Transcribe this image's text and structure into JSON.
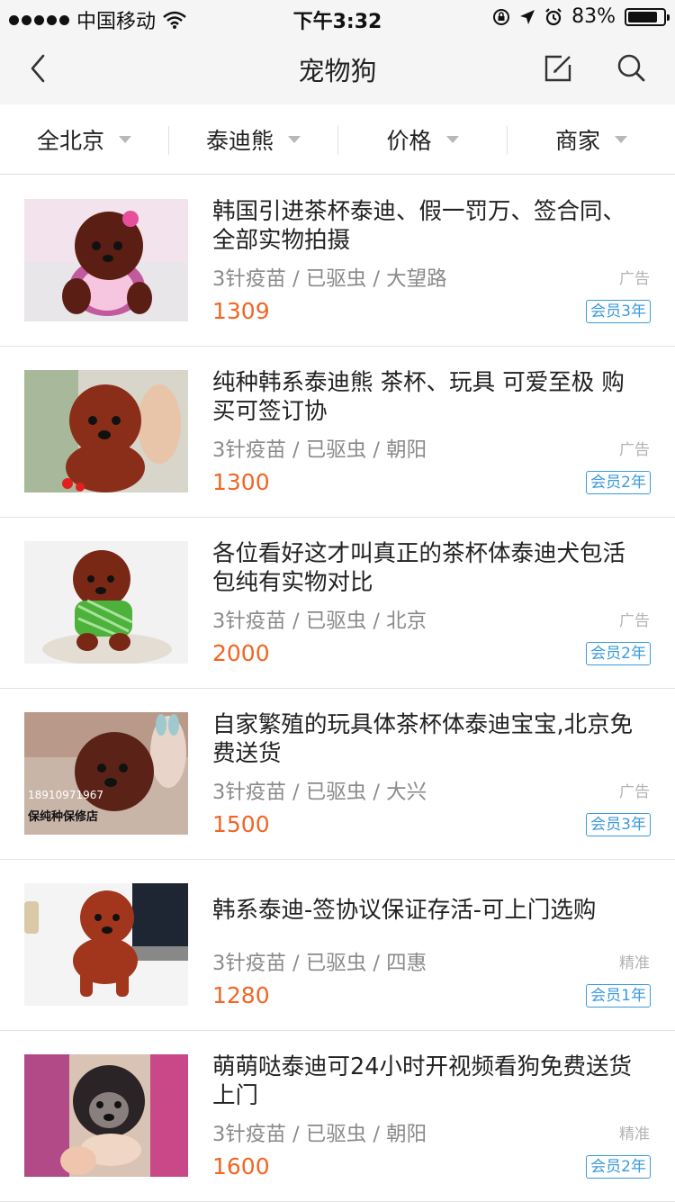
{
  "status_bar": {
    "carrier": "中国移动",
    "time": "下午3:32",
    "battery": "83%",
    "battery_level": 0.83
  },
  "nav": {
    "title": "宠物狗",
    "back_icon": "chevron-left-icon",
    "edit_icon": "edit-icon",
    "search_icon": "search-icon"
  },
  "filters": [
    {
      "label": "全北京"
    },
    {
      "label": "泰迪熊"
    },
    {
      "label": "价格"
    },
    {
      "label": "商家"
    }
  ],
  "colors": {
    "price": "#f26524",
    "member_badge": "#3b9bdc",
    "nav_bg": "#f5f5f5"
  },
  "listings": [
    {
      "title": "韩国引进茶杯泰迪、假一罚万、签合同、全部实物拍摄",
      "meta": "3针疫苗 / 已驱虫 / 大望路",
      "price": "1309",
      "tag": "广告",
      "member": "会员3年"
    },
    {
      "title": "纯种韩系泰迪熊 茶杯、玩具 可爱至极 购买可签订协",
      "meta": "3针疫苗 / 已驱虫 / 朝阳",
      "price": "1300",
      "tag": "广告",
      "member": "会员2年"
    },
    {
      "title": "各位看好这才叫真正的茶杯体泰迪犬包活包纯有实物对比",
      "meta": "3针疫苗 / 已驱虫 / 北京",
      "price": "2000",
      "tag": "广告",
      "member": "会员2年"
    },
    {
      "title": "自家繁殖的玩具体茶杯体泰迪宝宝,北京免费送货",
      "meta": "3针疫苗 / 已驱虫 / 大兴",
      "price": "1500",
      "tag": "广告",
      "member": "会员3年",
      "image_text": "18910971967 保纯种保修店"
    },
    {
      "title": "韩系泰迪-签协议保证存活-可上门选购",
      "meta": "3针疫苗 / 已驱虫 / 四惠",
      "price": "1280",
      "tag": "精准",
      "member": "会员1年"
    },
    {
      "title": "萌萌哒泰迪可24小时开视频看狗免费送货上门",
      "meta": "3针疫苗 / 已驱虫 / 朝阳",
      "price": "1600",
      "tag": "精准",
      "member": "会员2年"
    }
  ]
}
